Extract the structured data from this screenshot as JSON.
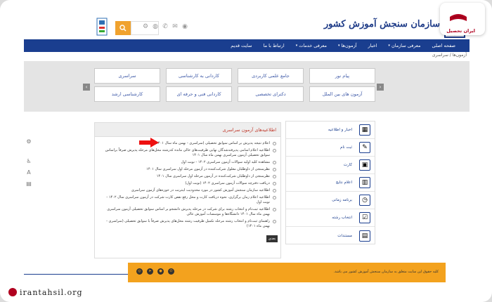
{
  "header": {
    "site_name": "سازمان سنجش آموزش کشور",
    "search_placeholder": ""
  },
  "nav": {
    "items": [
      {
        "label": "صفحه اصلی",
        "dropdown": false
      },
      {
        "label": "معرفی سازمان",
        "dropdown": true
      },
      {
        "label": "اخبار",
        "dropdown": false
      },
      {
        "label": "آزمون‌ها",
        "dropdown": true
      },
      {
        "label": "معرفی خدمات",
        "dropdown": true
      },
      {
        "label": "ارتباط با ما",
        "dropdown": false
      },
      {
        "label": "سایت قدیم",
        "dropdown": false
      }
    ]
  },
  "breadcrumb": "آزمون‌ها / سراسری",
  "slider": {
    "buttons": [
      "پیام نور",
      "جامع علمی کاربردی",
      "کاردانی به کارشناسی",
      "سراسری",
      "آزمون های بین الملل",
      "دکترای تخصصی",
      "کاردانی فنی و حرفه ای",
      "کارشناسی ارشد"
    ]
  },
  "news": {
    "title": "اطلاعیه‌های آزمون سراسری",
    "items": [
      "اعلام نتیجه پذیرش بر اساس سوابق تحصیلی (سراسری - بهمن ماه سال ۱۴۰۱)",
      "اطلاعیه اعلام اسامی پذیرفته‌شدگان نهایی ظرفیت‌های خالی مانده کدرشته محل‌های مرحله پذیرش صرفاً براساس سوابق تحصیلی آزمون سراسری بهمن ماه سال ۱۴۰۱",
      "مشاهده کلید اولیه سوالات آزمون سراسری ۱۴۰۲ - نوبت اول",
      "نظرسنجی از داوطلبان معلول شرکت‌کننده در آزمون مرحله اول سراسری سال ۱۴۰۱",
      "نظرسنجی از داوطلبان شرکت‌کننده در آزمون مرحله اول سراسری سال ۱۴۰۱",
      "دریافت دفترچه سوالات آزمون سراسری ۱۴۰۲ (نوبت اول)",
      "اطلاعیه سازمان سنجش آموزش کشور در مورد محدودیت اینترنت در حوزه‌های آزمون سراسری",
      "اطلاعیه اعلام زمان برگزاری، نحوه دریافت کارت و محل رفع نقص کارت شرکت در آزمون سراسری سال ۱۴۰۲ - نوبت اول",
      "اطلاعیه ثبت‌نام و انتخاب رشته برای شرکت در مرحله پذیرش دانشجو بر اساس سوابق تحصیلی آزمون سراسری بهمن ماه سال ۱۴۰۱ دانشگاه‌ها و موسسات آموزش عالی",
      "راهنمای ثبت‌نام و انتخاب رشته مرحله تکمیل ظرفیت رشته محل‌های پذیرش صرفاً با سوابق تحصیلی (سراسری - بهمن ماه ۱۴۰۱)"
    ],
    "more_label": "بعدی"
  },
  "menu": {
    "items": [
      {
        "label": "اخبار و اطلاعیه",
        "icon": "newspaper-icon"
      },
      {
        "label": "ثبت نام",
        "icon": "registration-icon"
      },
      {
        "label": "کارت",
        "icon": "card-icon"
      },
      {
        "label": "اعلام نتایج",
        "icon": "results-icon"
      },
      {
        "label": "برنامه زمانی",
        "icon": "calendar-icon"
      },
      {
        "label": "انتخاب رشته",
        "icon": "selection-icon"
      },
      {
        "label": "مستندات",
        "icon": "documents-icon"
      }
    ]
  },
  "footer": {
    "copyright": "کلیه حقوق این سایت متعلق به سازمان سنجش آموزش کشور می باشد."
  },
  "watermark": {
    "brand": "ایران تحصیل",
    "url": "irantahsil.org"
  },
  "colors": {
    "nav": "#1a3e8f",
    "accent": "#f3a21e",
    "news_title": "#c0392b"
  }
}
